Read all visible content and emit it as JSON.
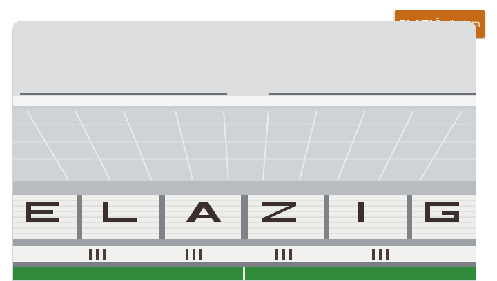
{
  "logo": {
    "brand_bold": "ELAZIĞ",
    "brand_light": "gündem"
  },
  "photo": {
    "seat_lettering": [
      "E",
      "L",
      "A",
      "Z",
      "I",
      "Ğ"
    ]
  },
  "colors": {
    "logo_bg": "#c76a18",
    "sky": "#dcdee0",
    "roof": "#eef0f1",
    "seats": "#f1f1f0",
    "seat_letters": "#3b2f2b",
    "pitch": "#2f8a3a"
  }
}
